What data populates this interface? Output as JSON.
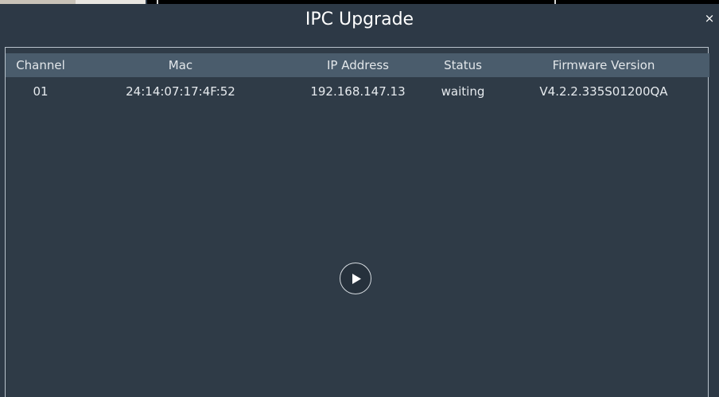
{
  "dialog": {
    "title": "IPC Upgrade",
    "close_label": "×"
  },
  "table": {
    "columns": [
      "Channel",
      "Mac",
      "IP Address",
      "Status",
      "Firmware Version"
    ],
    "rows": [
      {
        "channel": "01",
        "mac": "24:14:07:17:4F:52",
        "ip": "192.168.147.13",
        "status": "waiting",
        "firmware": "V4.2.2.335S01200QA"
      }
    ]
  },
  "icons": {
    "close": "close-icon",
    "play": "play-icon"
  },
  "colors": {
    "background": "#2d3946",
    "header_row": "#4a5c6c",
    "text": "#ffffff"
  }
}
